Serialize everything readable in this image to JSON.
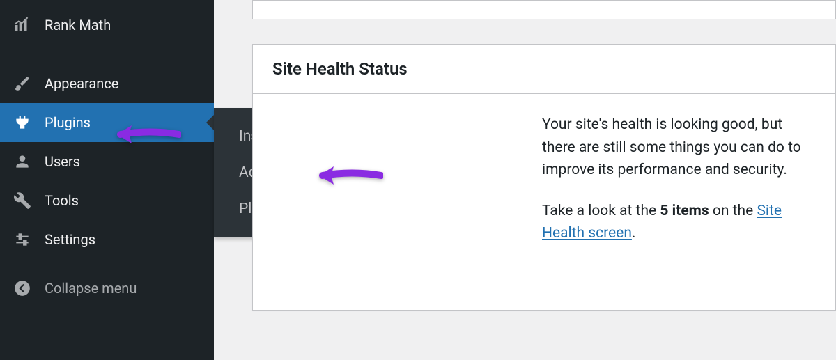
{
  "sidebar": {
    "items": [
      {
        "label": "Rank Math",
        "icon": "rankmath"
      },
      {
        "label": "Appearance",
        "icon": "brush"
      },
      {
        "label": "Plugins",
        "icon": "plug",
        "active": true
      },
      {
        "label": "Users",
        "icon": "user"
      },
      {
        "label": "Tools",
        "icon": "wrench"
      },
      {
        "label": "Settings",
        "icon": "sliders"
      }
    ],
    "collapse_label": "Collapse menu"
  },
  "submenu": {
    "items": [
      {
        "label": "Installed Plugins"
      },
      {
        "label": "Add New"
      },
      {
        "label": "Plugin Editor"
      }
    ]
  },
  "health_card": {
    "title": "Site Health Status",
    "body_line1": "Your site's health is looking good, but there are still some things you can do to improve its performance and security.",
    "body_line2_pre": "Take a look at the ",
    "body_line2_strong": "5 items",
    "body_line2_mid": " on the ",
    "body_line2_link": "Site Health screen",
    "body_line2_post": "."
  }
}
